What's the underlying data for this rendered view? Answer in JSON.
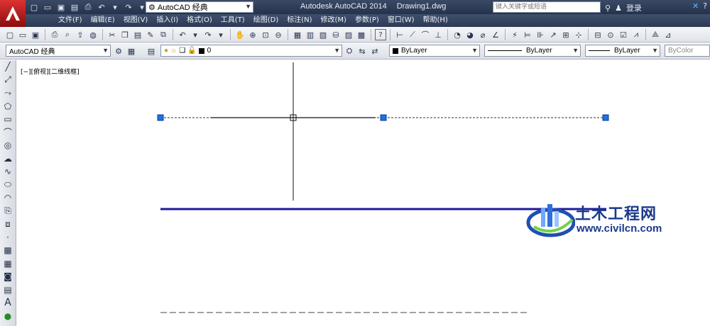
{
  "app": {
    "logo_letter": "A",
    "title": "Autodesk AutoCAD 2014",
    "document": "Drawing1.dwg",
    "workspace": "AutoCAD 经典",
    "search_placeholder": "键入关键字或短语",
    "login_label": "登录"
  },
  "quick_access": [
    "new-icon",
    "open-icon",
    "save-icon",
    "save-as-icon",
    "print-icon",
    "undo-icon",
    "redo-icon"
  ],
  "menu": {
    "items": [
      "文件(F)",
      "编辑(E)",
      "视图(V)",
      "插入(I)",
      "格式(O)",
      "工具(T)",
      "绘图(D)",
      "标注(N)",
      "修改(M)",
      "参数(P)",
      "窗口(W)",
      "帮助(H)"
    ]
  },
  "toolbar2": {
    "workspace": "AutoCAD 经典",
    "layer": "0",
    "color": "ByLayer",
    "linetype": "ByLayer",
    "lineweight": "ByLayer",
    "plotstyle": "ByColor"
  },
  "canvas": {
    "viewport_label": "[−][俯视][二维线框]"
  },
  "watermark": {
    "title": "土木工程网",
    "url": "www.civilcn.com"
  },
  "colors": {
    "accent": "#1f5fcc",
    "grip": "#1a73e8",
    "line_blue": "#1f1a9a",
    "title_bar": "#2d3a55"
  }
}
